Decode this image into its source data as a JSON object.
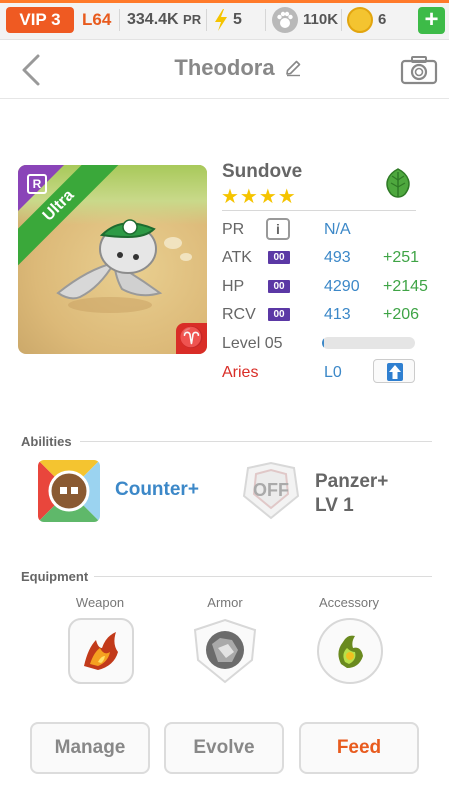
{
  "status_bar": {
    "vip": "VIP 3",
    "level": "L64",
    "power_value": "334.4K",
    "power_unit": "PR",
    "energy": "5",
    "paws": "110K",
    "coins": "6",
    "add_label": "+"
  },
  "header": {
    "title": "Theodora"
  },
  "creature": {
    "name": "Sundove",
    "rarity": "Ultra",
    "rank_badge": "R",
    "stars": "★★★★",
    "element_icon": "leaf-icon",
    "zodiac_icon": "♈"
  },
  "stats": {
    "pr_label": "PR",
    "info_label": "i",
    "pr_value": "N/A",
    "atk_label": "ATK",
    "atk_badge": "00",
    "atk_value": "493",
    "atk_bonus": "+251",
    "hp_label": "HP",
    "hp_badge": "00",
    "hp_value": "4290",
    "hp_bonus": "+2145",
    "rcv_label": "RCV",
    "rcv_badge": "00",
    "rcv_value": "413",
    "rcv_bonus": "+206",
    "level_label": "Level 05",
    "level_progress": 0.02,
    "zodiac_label": "Aries",
    "zodiac_level": "L0"
  },
  "abilities": {
    "title": "Abilities",
    "items": [
      {
        "name": "Counter+"
      },
      {
        "name": "Panzer+",
        "sub": "LV 1",
        "state": "OFF"
      }
    ]
  },
  "equipment": {
    "title": "Equipment",
    "slots": [
      "Weapon",
      "Armor",
      "Accessory"
    ]
  },
  "actions": {
    "manage": "Manage",
    "evolve": "Evolve",
    "feed": "Feed"
  },
  "colors": {
    "accent_orange": "#ef5a22",
    "blue": "#3c88c8",
    "green": "#3fa446",
    "purple": "#5b38a5",
    "red": "#d92d27"
  }
}
